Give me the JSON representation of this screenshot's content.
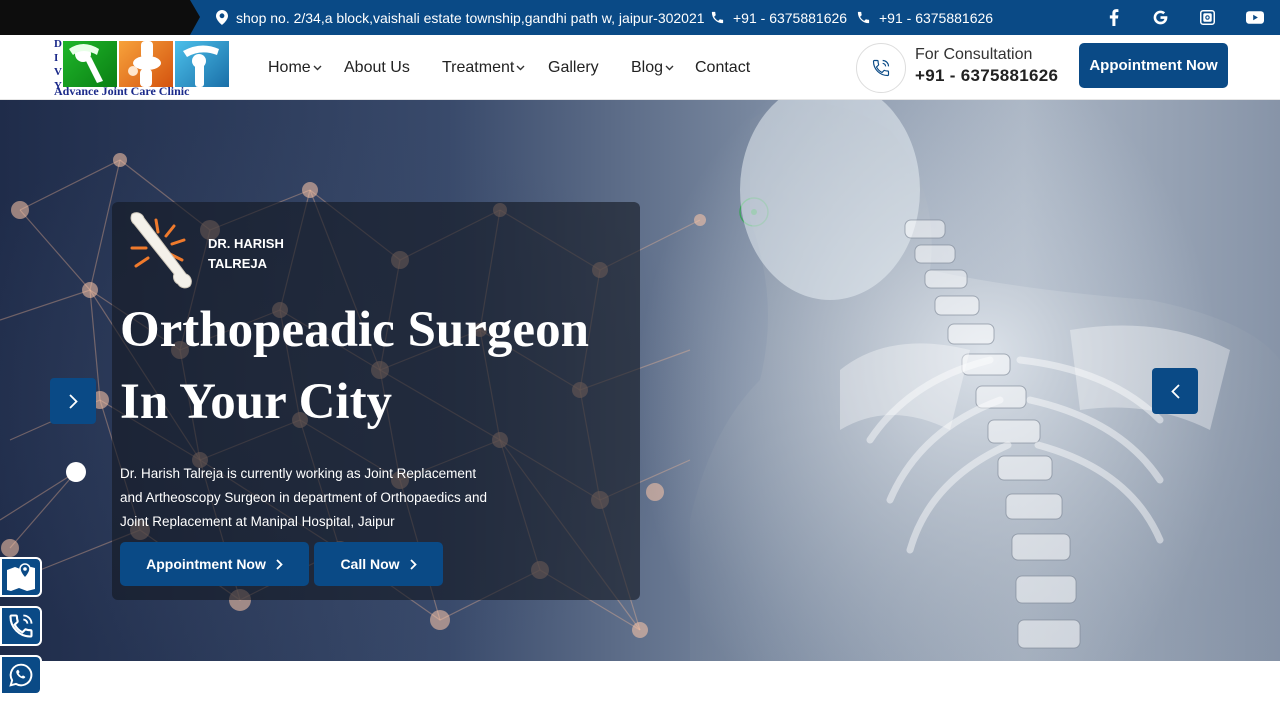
{
  "topbar": {
    "address": "shop no. 2/34,a block,vaishali estate township,gandhi path w, jaipur-302021",
    "phone1": "+91 - 6375881626",
    "phone2": "+91 - 6375881626",
    "socials": [
      "facebook-icon",
      "google-icon",
      "instagram-icon",
      "youtube-icon"
    ]
  },
  "logo": {
    "letters": [
      "D",
      "I",
      "V",
      "Y"
    ],
    "text": "Advance Joint Care Clinic"
  },
  "nav": {
    "items": [
      {
        "label": "Home",
        "dropdown": true
      },
      {
        "label": "About Us",
        "dropdown": false
      },
      {
        "label": "Treatment",
        "dropdown": true
      },
      {
        "label": "Gallery",
        "dropdown": false
      },
      {
        "label": "Blog",
        "dropdown": true
      },
      {
        "label": "Contact",
        "dropdown": false
      }
    ]
  },
  "consult": {
    "label": "For Consultation",
    "phone": "+91 - 6375881626"
  },
  "header_cta": "Appointment Now",
  "hero": {
    "doctor_line1": "DR. HARISH",
    "doctor_line2": "TALREJA",
    "title_line1": "Orthopeadic Surgeon",
    "title_line2": "In Your City",
    "description": "Dr. Harish Talreja is currently working as Joint Replacement and Artheoscopy Surgeon in department of Orthopaedics and Joint Replacement at Manipal Hospital, Jaipur",
    "btn_appointment": "Appointment Now",
    "btn_call": "Call Now"
  },
  "colors": {
    "brand_blue": "#0a4a86",
    "topbar_black": "#0d0d0d"
  }
}
